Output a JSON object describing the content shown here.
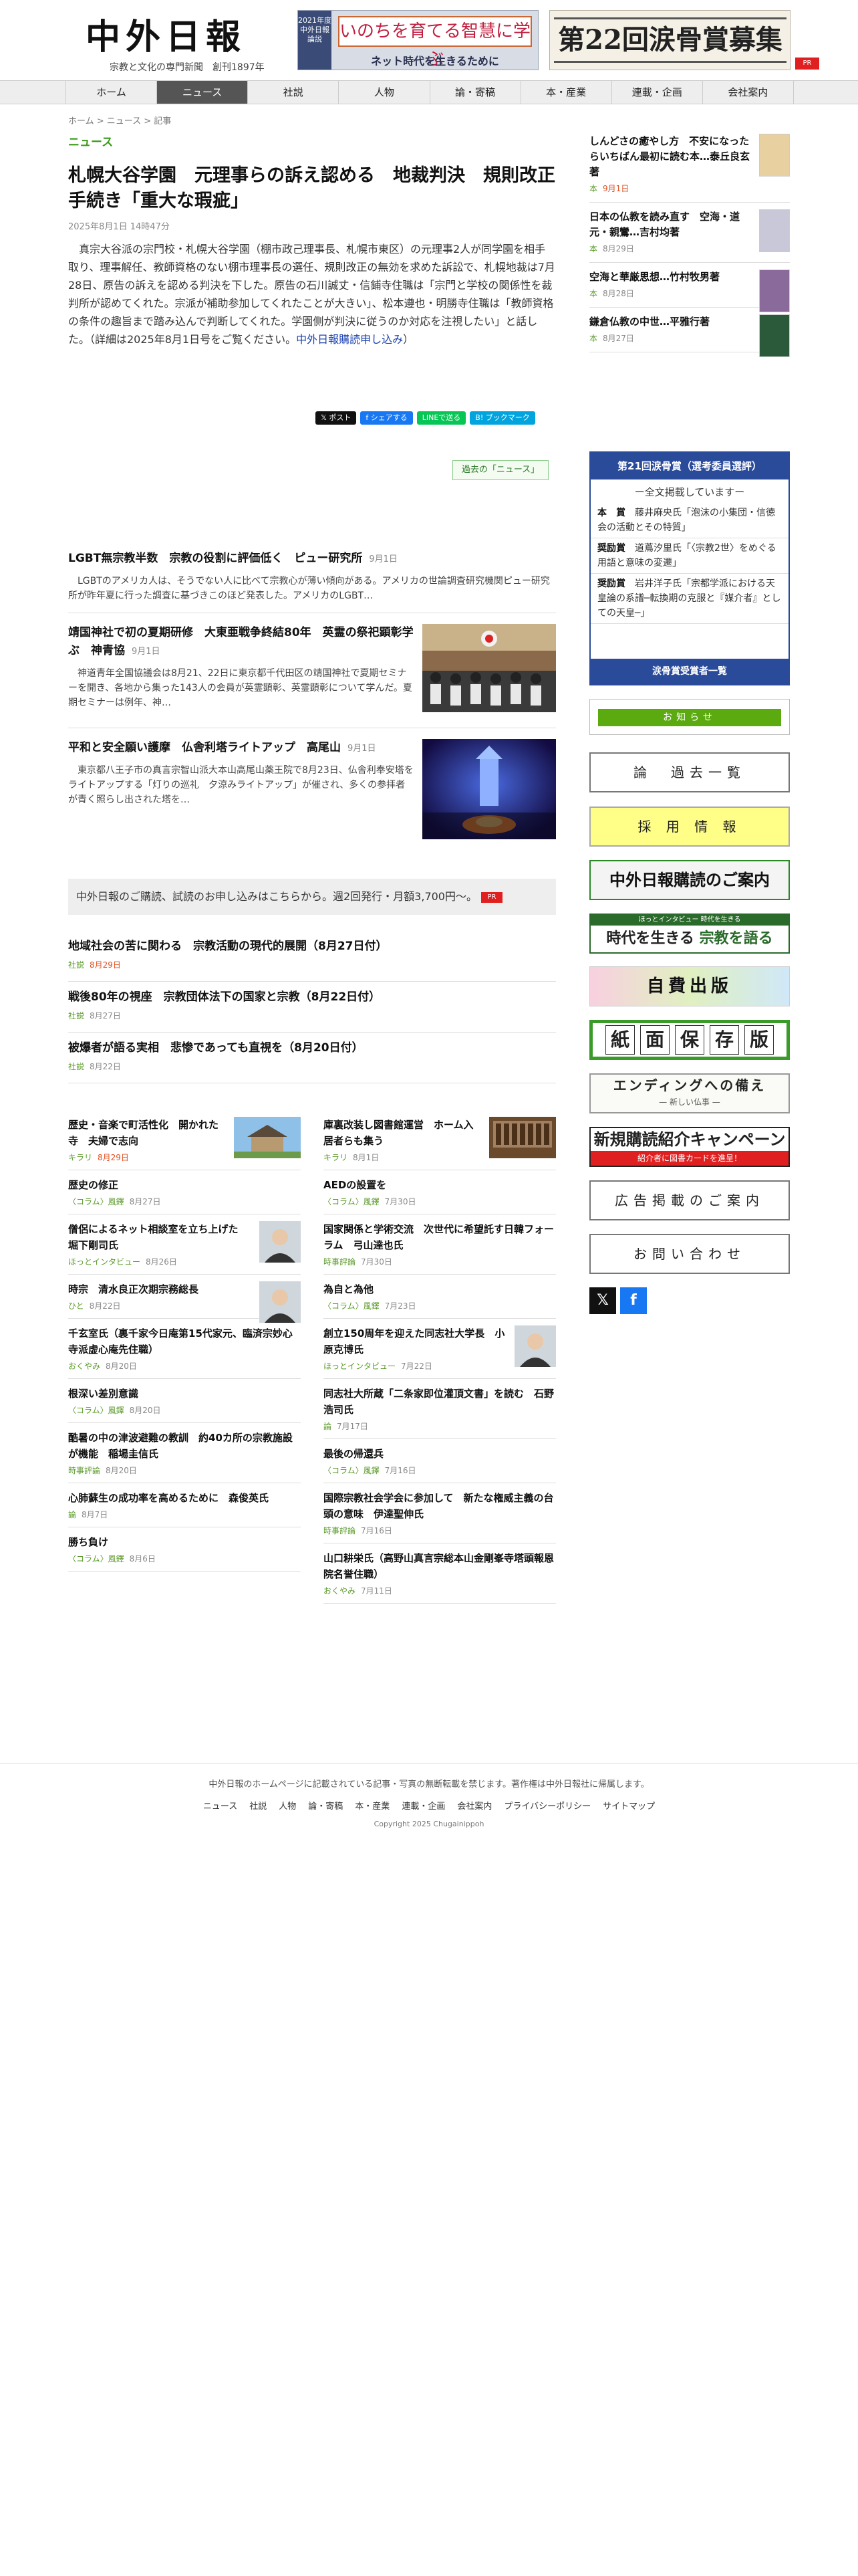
{
  "header": {
    "logo": "中外日報",
    "tagline": "宗教と文化の専門新聞",
    "founded": "創刊1897年",
    "banner1": {
      "side": "2021年度 中外日報 論説",
      "headline": "いのちを育てる智慧に学ぶ",
      "sub": "ネット時代を生きるために"
    },
    "banner2": {
      "headline": "第22回涙骨賞募集"
    },
    "pr": "PR"
  },
  "nav": [
    "ホーム",
    "ニュース",
    "社説",
    "人物",
    "論・寄稿",
    "本・産業",
    "連載・企画",
    "会社案内"
  ],
  "breadcrumb": "ホーム > ニュース > 記事",
  "section_label": "ニュース",
  "article": {
    "title": "札幌大谷学園　元理事らの訴え認める　地裁判決　規則改正手続き「重大な瑕疵」",
    "date": "2025年8月1日 14時47分",
    "body": "真宗大谷派の宗門校・札幌大谷学園（棚市政己理事長、札幌市東区）の元理事2人が同学園を相手取り、理事解任、教師資格のない棚市理事長の選任、規則改正の無効を求めた訴訟で、札幌地裁は7月28日、原告の訴えを認める判決を下した。原告の石川誠丈・信鋪寺住職は「宗門と学校の関係性を裁判所が認めてくれた。宗派が補助参加してくれたことが大きい」、松本遵也・明勝寺住職は「教師資格の条件の趣旨まで踏み込んで判断してくれた。学園側が判決に従うのか対応を注視したい」と話した。（詳細は2025年8月1日号をご覧ください。",
    "body_link": "中外日報購読申し込み",
    "body_end": "）"
  },
  "share": {
    "x": "ポスト",
    "fb": "シェアする",
    "line": "LINEで送る",
    "hatena": "B! ブックマーク"
  },
  "past_link": "過去の「ニュース」",
  "stories": [
    {
      "title": "LGBT無宗教半数　宗教の役割に評価低く　ピュー研究所",
      "date": "9月1日",
      "excerpt": "LGBTのアメリカ人は、そうでない人に比べて宗教心が薄い傾向がある。アメリカの世論調査研究機関ピュー研究所が昨年夏に行った調査に基づきこのほど発表した。アメリカのLGBT…"
    },
    {
      "title": "靖国神社で初の夏期研修　大東亜戦争終結80年　英霊の祭祀顕彰学ぶ　神青協",
      "date": "9月1日",
      "excerpt": "神道青年全国協議会は8月21、22日に東京都千代田区の靖国神社で夏期セミナーを開き、各地から集った143人の会員が英霊顕彰、英霊顕彰について学んだ。夏期セミナーは例年、神…"
    },
    {
      "title": "平和と安全願い護摩　仏舎利塔ライトアップ　高尾山",
      "date": "9月1日",
      "excerpt": "東京都八王子市の真言宗智山派大本山高尾山薬王院で8月23日、仏舎利奉安塔をライトアップする「灯りの巡礼　夕涼みライトアップ」が催され、多くの参拝者が青く照らし出された塔を…"
    }
  ],
  "promo": {
    "text": "中外日報のご購読、試読のお申し込みはこちらから。週2回発行・月額3,700円～。",
    "pr": "PR"
  },
  "features": [
    {
      "title": "地域社会の苦に関わる　宗教活動の現代的展開（8月27日付）",
      "cat": "社説",
      "date": "8月29日",
      "red": true
    },
    {
      "title": "戦後80年の視座　宗教団体法下の国家と宗教（8月22日付）",
      "cat": "社説",
      "date": "8月27日",
      "red": false
    },
    {
      "title": "被爆者が語る実相　悲惨であっても直視を（8月20日付）",
      "cat": "社説",
      "date": "8月22日",
      "red": false
    }
  ],
  "grid_left": [
    {
      "title": "歴史・音楽で町活性化　開かれた寺　夫婦で志向",
      "cat": "キラリ",
      "date": "8月29日",
      "red": true,
      "thumb": "wide"
    },
    {
      "title": "歴史の修正",
      "cat": "〈コラム〉風鐸",
      "date": "8月27日"
    },
    {
      "title": "僧侶によるネット相談室を立ち上げた　堀下剛司氏",
      "cat": "ほっとインタビュー",
      "date": "8月26日",
      "thumb": "face"
    },
    {
      "title": "時宗　清水良正次期宗務総長",
      "cat": "ひと",
      "date": "8月22日",
      "thumb": "face"
    },
    {
      "title": "千玄室氏（裏千家今日庵第15代家元、臨済宗妙心寺派虚心庵先住職）",
      "cat": "おくやみ",
      "date": "8月20日"
    },
    {
      "title": "根深い差別意識",
      "cat": "〈コラム〉風鐸",
      "date": "8月20日"
    },
    {
      "title": "酷暑の中の津波避難の教訓　約40カ所の宗教施設が機能　稲場圭信氏",
      "cat": "時事評論",
      "date": "8月20日"
    },
    {
      "title": "心肺蘇生の成功率を高めるために　森俊英氏",
      "cat": "論",
      "date": "8月7日"
    },
    {
      "title": "勝ち負け",
      "cat": "〈コラム〉風鐸",
      "date": "8月6日"
    }
  ],
  "grid_right": [
    {
      "title": "庫裏改装し図書館運営　ホーム入居者らも集う",
      "cat": "キラリ",
      "date": "8月1日",
      "thumb": "wide2"
    },
    {
      "title": "AEDの設置を",
      "cat": "〈コラム〉風鐸",
      "date": "7月30日"
    },
    {
      "title": "国家関係と学術交流　次世代に希望託す日韓フォーラム　弓山達也氏",
      "cat": "時事評論",
      "date": "7月30日"
    },
    {
      "title": "為自と為他",
      "cat": "〈コラム〉風鐸",
      "date": "7月23日"
    },
    {
      "title": "創立150周年を迎えた同志社大学長　小原克博氏",
      "cat": "ほっとインタビュー",
      "date": "7月22日",
      "thumb": "face"
    },
    {
      "title": "同志社大所蔵「二条家即位灌頂文書」を読む　石野浩司氏",
      "cat": "論",
      "date": "7月17日"
    },
    {
      "title": "最後の帰還兵",
      "cat": "〈コラム〉風鐸",
      "date": "7月16日"
    },
    {
      "title": "国際宗教社会学会に参加して　新たな権威主義の台頭の意味　伊達聖伸氏",
      "cat": "時事評論",
      "date": "7月16日"
    },
    {
      "title": "山口耕栄氏（高野山真言宗総本山金剛峯寺塔頭報恩院名誉住職）",
      "cat": "おくやみ",
      "date": "7月11日"
    }
  ],
  "sidebar_books": [
    {
      "title": "しんどさの癒やし方　不安になったらいちばん最初に読む本…泰丘良玄著",
      "cat": "本",
      "date": "9月1日",
      "red": true
    },
    {
      "title": "日本の仏教を読み直す　空海・道元・親鸞…吉村均著",
      "cat": "本",
      "date": "8月29日"
    },
    {
      "title": "空海と華厳思想…竹村牧男著",
      "cat": "本",
      "date": "8月28日"
    },
    {
      "title": "鎌倉仏教の中世…平雅行著",
      "cat": "本",
      "date": "8月27日"
    }
  ],
  "award": {
    "head": "第21回涙骨賞（選考委員選評）",
    "sub": "ー全文掲載していますー",
    "entries": [
      {
        "rank": "本　賞",
        "text": "藤井麻央氏「泡沫の小集団・信徳会の活動とその特質」"
      },
      {
        "rank": "奨励賞",
        "text": "道蔦汐里氏「〈宗教2世〉をめぐる用語と意味の変遷」"
      },
      {
        "rank": "奨励賞",
        "text": "岩井洋子氏「宗都学派における天皇論の系譜─転換期の克服と『媒介者』としての天皇─」"
      }
    ],
    "foot": "涙骨賞受賞者一覧"
  },
  "side_buttons": {
    "notice": "お知らせ",
    "ronsetsu": "論　過去一覧",
    "saiyo": "採 用 情 報",
    "subscribe": "中外日報購読のご案内",
    "jidai_top": "ほっとインタビュー 時代を生きる",
    "jidai_a": "時代を生きる",
    "jidai_b": "宗教を語る",
    "jihi": "自費出版",
    "hozon": [
      "紙",
      "面",
      "保",
      "存",
      "版"
    ],
    "ending_a": "エンディングへの備え",
    "ending_b": "— 新しい仏事 —",
    "campaign_a": "新規購読紹介キャンペーン",
    "campaign_b": "紹介者に図書カードを進呈！",
    "ad": "広告掲載のご案内",
    "inquiry": "お問い合わせ"
  },
  "footer": {
    "note": "中外日報のホームページに記載されている記事・写真の無断転載を禁じます。著作権は中外日報社に帰属します。",
    "links": [
      "ニュース",
      "社説",
      "人物",
      "論・寄稿",
      "本・産業",
      "連載・企画",
      "会社案内",
      "プライバシーポリシー",
      "サイトマップ"
    ],
    "copyright": "Copyright 2025 Chugainippoh"
  },
  "colors": {
    "accent_green": "#3a9a1a",
    "nav_active": "#555555",
    "award_blue": "#2a4a9a",
    "pr_red": "#e02020"
  }
}
